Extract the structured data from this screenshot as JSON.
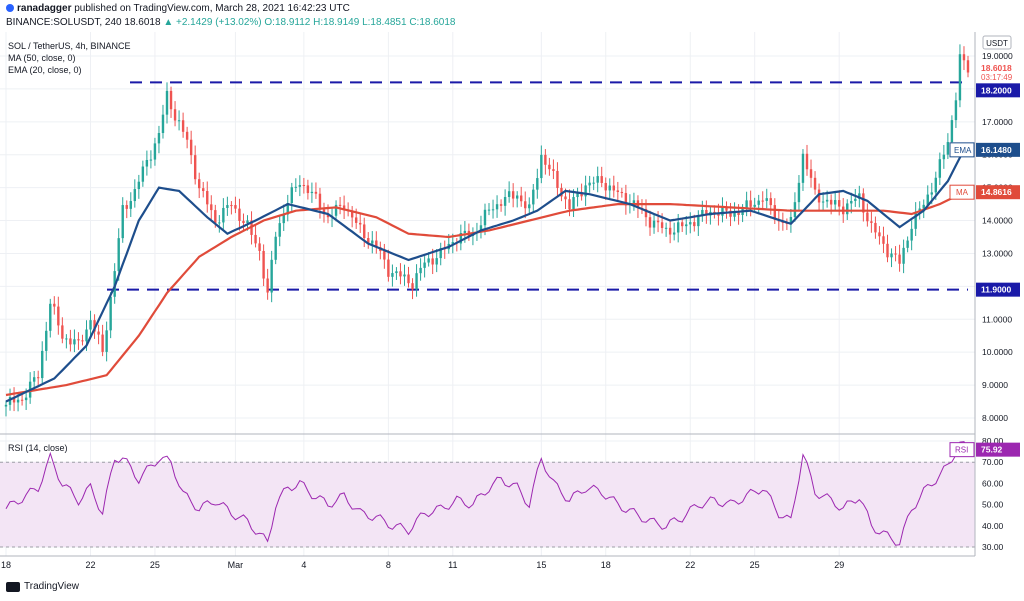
{
  "header": {
    "author": "ranadagger",
    "published": "published on TradingView.com, March 28, 2021 16:42:23 UTC",
    "symbol_line": "BINANCE:SOLUSDT, 240",
    "last": "18.6018",
    "change": "▲ +2.1429 (+13.02%)",
    "ohlc": "O:18.9112 H:18.9149 L:18.4851 C:18.6018"
  },
  "legend": {
    "title": "SOL / TetherUS, 4h, BINANCE",
    "ma": "MA (50, close, 0)",
    "ema": "EMA (20, close, 0)"
  },
  "rsi_legend": "RSI (14, close)",
  "footer": {
    "brand": "TradingView"
  },
  "colors": {
    "up": "#26a69a",
    "down": "#ef5350",
    "ema": "#1e4e8c",
    "ma": "#e04b3a",
    "rsi": "#9c27b0",
    "rsi_band": "#f3e5f5",
    "level": "#1a1aa8"
  },
  "chart_data": {
    "type": "candlestick",
    "x_tick_labels": [
      "18",
      "22",
      "25",
      "Mar",
      "4",
      "8",
      "11",
      "15",
      "18",
      "22",
      "25",
      "29"
    ],
    "y_ticks": [
      "19.0000",
      "18.0000",
      "17.0000",
      "16.0000",
      "15.0000",
      "14.0000",
      "13.0000",
      "12.0000",
      "11.0000",
      "10.0000",
      "9.0000",
      "8.0000"
    ],
    "ylim": [
      7.6,
      19.8
    ],
    "currency": "USDT",
    "price_labels": {
      "last": "18.6018",
      "countdown": "03:17:49",
      "ema_tag": "EMA",
      "ema_value": "16.1480",
      "ma_tag": "MA",
      "ma_value": "14.8616"
    },
    "levels": [
      {
        "value": 18.2,
        "label": "18.2000"
      },
      {
        "value": 11.9,
        "label": "11.9000"
      }
    ],
    "ema_keypoints": [
      [
        0,
        8.5
      ],
      [
        12,
        9.2
      ],
      [
        20,
        10.2
      ],
      [
        27,
        12.0
      ],
      [
        33,
        14.0
      ],
      [
        38,
        15.0
      ],
      [
        43,
        14.9
      ],
      [
        50,
        14.1
      ],
      [
        55,
        13.6
      ],
      [
        62,
        14.0
      ],
      [
        70,
        14.5
      ],
      [
        80,
        14.2
      ],
      [
        90,
        13.3
      ],
      [
        100,
        12.8
      ],
      [
        110,
        13.2
      ],
      [
        118,
        13.7
      ],
      [
        126,
        14.0
      ],
      [
        132,
        14.3
      ],
      [
        139,
        14.9
      ],
      [
        145,
        14.8
      ],
      [
        155,
        14.5
      ],
      [
        165,
        14.0
      ],
      [
        175,
        14.2
      ],
      [
        185,
        14.3
      ],
      [
        195,
        13.9
      ],
      [
        202,
        14.8
      ],
      [
        208,
        14.9
      ],
      [
        214,
        14.6
      ],
      [
        222,
        13.8
      ],
      [
        228,
        14.3
      ],
      [
        234,
        15.2
      ],
      [
        238,
        16.15
      ]
    ],
    "ma_keypoints": [
      [
        0,
        8.7
      ],
      [
        15,
        9.0
      ],
      [
        25,
        9.3
      ],
      [
        33,
        10.5
      ],
      [
        40,
        11.8
      ],
      [
        48,
        12.9
      ],
      [
        56,
        13.5
      ],
      [
        64,
        14.0
      ],
      [
        72,
        14.3
      ],
      [
        82,
        14.4
      ],
      [
        92,
        14.1
      ],
      [
        100,
        13.6
      ],
      [
        110,
        13.5
      ],
      [
        120,
        13.7
      ],
      [
        130,
        14.0
      ],
      [
        140,
        14.3
      ],
      [
        152,
        14.5
      ],
      [
        165,
        14.5
      ],
      [
        180,
        14.4
      ],
      [
        195,
        14.3
      ],
      [
        208,
        14.3
      ],
      [
        218,
        14.3
      ],
      [
        225,
        14.2
      ],
      [
        232,
        14.5
      ],
      [
        238,
        14.86
      ]
    ],
    "close_keypoints": [
      [
        0,
        8.4
      ],
      [
        4,
        8.6
      ],
      [
        8,
        9.3
      ],
      [
        11,
        11.5
      ],
      [
        14,
        10.5
      ],
      [
        18,
        10.2
      ],
      [
        21,
        11.0
      ],
      [
        24,
        10.0
      ],
      [
        27,
        12.5
      ],
      [
        29,
        14.3
      ],
      [
        32,
        14.9
      ],
      [
        35,
        15.8
      ],
      [
        38,
        16.6
      ],
      [
        40,
        17.8
      ],
      [
        42,
        17.2
      ],
      [
        45,
        16.4
      ],
      [
        48,
        15.0
      ],
      [
        52,
        14.0
      ],
      [
        56,
        14.5
      ],
      [
        60,
        13.8
      ],
      [
        63,
        13.1
      ],
      [
        65,
        11.7
      ],
      [
        67,
        13.6
      ],
      [
        70,
        14.6
      ],
      [
        73,
        15.2
      ],
      [
        76,
        14.8
      ],
      [
        80,
        14.1
      ],
      [
        84,
        14.5
      ],
      [
        88,
        13.7
      ],
      [
        92,
        13.2
      ],
      [
        95,
        12.5
      ],
      [
        98,
        12.3
      ],
      [
        101,
        12.1
      ],
      [
        104,
        12.7
      ],
      [
        108,
        13.0
      ],
      [
        112,
        13.5
      ],
      [
        116,
        13.6
      ],
      [
        120,
        14.3
      ],
      [
        123,
        14.6
      ],
      [
        127,
        14.8
      ],
      [
        130,
        14.3
      ],
      [
        133,
        16.0
      ],
      [
        136,
        15.3
      ],
      [
        140,
        14.4
      ],
      [
        144,
        15.1
      ],
      [
        148,
        15.2
      ],
      [
        152,
        14.8
      ],
      [
        156,
        14.5
      ],
      [
        160,
        14.0
      ],
      [
        164,
        13.7
      ],
      [
        168,
        13.8
      ],
      [
        172,
        14.1
      ],
      [
        176,
        14.3
      ],
      [
        180,
        14.2
      ],
      [
        184,
        14.4
      ],
      [
        188,
        14.7
      ],
      [
        192,
        14.0
      ],
      [
        195,
        13.9
      ],
      [
        198,
        16.0
      ],
      [
        201,
        14.8
      ],
      [
        205,
        14.5
      ],
      [
        208,
        14.4
      ],
      [
        212,
        14.7
      ],
      [
        215,
        13.8
      ],
      [
        219,
        13.1
      ],
      [
        222,
        12.7
      ],
      [
        225,
        13.9
      ],
      [
        228,
        14.5
      ],
      [
        231,
        15.3
      ],
      [
        234,
        16.4
      ],
      [
        236,
        17.8
      ],
      [
        237,
        18.9
      ],
      [
        239,
        18.6
      ]
    ],
    "rsi": {
      "ylim": [
        28,
        82
      ],
      "y_ticks": [
        "80.00",
        "70.00",
        "60.00",
        "50.00",
        "40.00",
        "30.00"
      ],
      "band": [
        30,
        70
      ],
      "last": "75.92",
      "tag": "RSI",
      "keypoints": [
        [
          0,
          48
        ],
        [
          8,
          58
        ],
        [
          11,
          72
        ],
        [
          14,
          60
        ],
        [
          18,
          52
        ],
        [
          21,
          58
        ],
        [
          24,
          46
        ],
        [
          27,
          72
        ],
        [
          29,
          72
        ],
        [
          33,
          62
        ],
        [
          38,
          72
        ],
        [
          41,
          70
        ],
        [
          44,
          55
        ],
        [
          48,
          48
        ],
        [
          52,
          52
        ],
        [
          56,
          46
        ],
        [
          60,
          42
        ],
        [
          63,
          36
        ],
        [
          65,
          32
        ],
        [
          67,
          50
        ],
        [
          70,
          58
        ],
        [
          73,
          60
        ],
        [
          76,
          55
        ],
        [
          80,
          50
        ],
        [
          84,
          54
        ],
        [
          88,
          46
        ],
        [
          92,
          44
        ],
        [
          96,
          40
        ],
        [
          100,
          38
        ],
        [
          104,
          46
        ],
        [
          108,
          48
        ],
        [
          112,
          52
        ],
        [
          116,
          50
        ],
        [
          120,
          58
        ],
        [
          123,
          62
        ],
        [
          127,
          58
        ],
        [
          130,
          50
        ],
        [
          133,
          72
        ],
        [
          136,
          60
        ],
        [
          140,
          52
        ],
        [
          144,
          58
        ],
        [
          148,
          56
        ],
        [
          152,
          50
        ],
        [
          156,
          46
        ],
        [
          160,
          42
        ],
        [
          164,
          40
        ],
        [
          168,
          44
        ],
        [
          172,
          50
        ],
        [
          176,
          52
        ],
        [
          180,
          50
        ],
        [
          184,
          54
        ],
        [
          188,
          58
        ],
        [
          192,
          46
        ],
        [
          195,
          42
        ],
        [
          198,
          74
        ],
        [
          201,
          56
        ],
        [
          205,
          52
        ],
        [
          208,
          48
        ],
        [
          212,
          54
        ],
        [
          215,
          40
        ],
        [
          219,
          35
        ],
        [
          222,
          32
        ],
        [
          225,
          48
        ],
        [
          228,
          56
        ],
        [
          231,
          62
        ],
        [
          234,
          68
        ],
        [
          237,
          79
        ],
        [
          239,
          75.92
        ]
      ]
    }
  }
}
